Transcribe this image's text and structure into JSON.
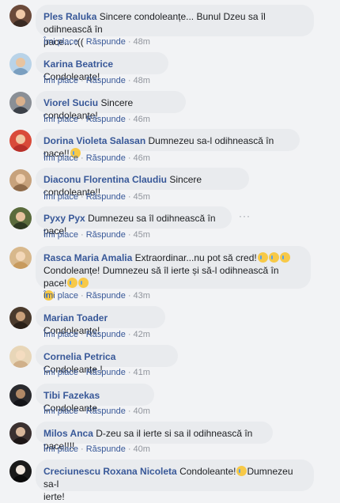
{
  "comments": [
    {
      "name": "Ples Raluka",
      "line1": "Sincere condoleanțe... Bunul Dzeu sa îl odihnească în",
      "line2": "pace... :((",
      "like": "Îmi place",
      "reply": "Răspunde",
      "time": "48m"
    },
    {
      "name": "Karina Beatrice",
      "line1": "Condoleanțe!",
      "like": "Îmi place",
      "reply": "Răspunde",
      "time": "48m"
    },
    {
      "name": "Viorel Suciu",
      "line1": "Sincere condoleanțe!",
      "like": "Îmi place",
      "reply": "Răspunde",
      "time": "46m"
    },
    {
      "name": "Dorina Violeta Salasan",
      "line1": "Dumnezeu sa-l odihnească în pace!!",
      "like": "Îmi place",
      "reply": "Răspunde",
      "time": "46m"
    },
    {
      "name": "Diaconu Florentina Claudiu",
      "line1": "Sincere condoleante!!",
      "like": "Îmi place",
      "reply": "Răspunde",
      "time": "45m"
    },
    {
      "name": "Pyxy Pyx",
      "line1": "Dumnezeu sa îl odihnească în pace!",
      "like": "Îmi place",
      "reply": "Răspunde",
      "time": "45m"
    },
    {
      "name": "Rasca Maria Amalia",
      "line1": "Extraordinar...nu pot să cred!",
      "line2": "Condoleanțe! Dumnezeu să îl ierte și să-l odihnească în pace!",
      "like": "Îmi place",
      "reply": "Răspunde",
      "time": "43m"
    },
    {
      "name": "Marian Toader",
      "line1": "Condoleanțe!",
      "like": "Îmi place",
      "reply": "Răspunde",
      "time": "42m"
    },
    {
      "name": "Cornelia Petrica",
      "line1": "Condoleanțe !",
      "like": "Îmi place",
      "reply": "Răspunde",
      "time": "41m"
    },
    {
      "name": "Tibi Fazekas",
      "line1": "Condoleante",
      "like": "Îmi place",
      "reply": "Răspunde",
      "time": "40m"
    },
    {
      "name": "Milos Anca",
      "line1": "D-zeu sa il ierte si sa il odihnească în pace!!!!",
      "like": "Îmi place",
      "reply": "Răspunde",
      "time": "40m"
    },
    {
      "name": "Creciunescu Roxana Nicoleta",
      "line1": "Condoleante!",
      "line1b": "Dumnezeu sa-l",
      "line2": "ierte!"
    }
  ],
  "more_icon": "more-options-icon",
  "colors": {
    "name": "#385898",
    "bubble": "#e9ebee",
    "time": "#90949c",
    "background": "#f2f3f5"
  }
}
